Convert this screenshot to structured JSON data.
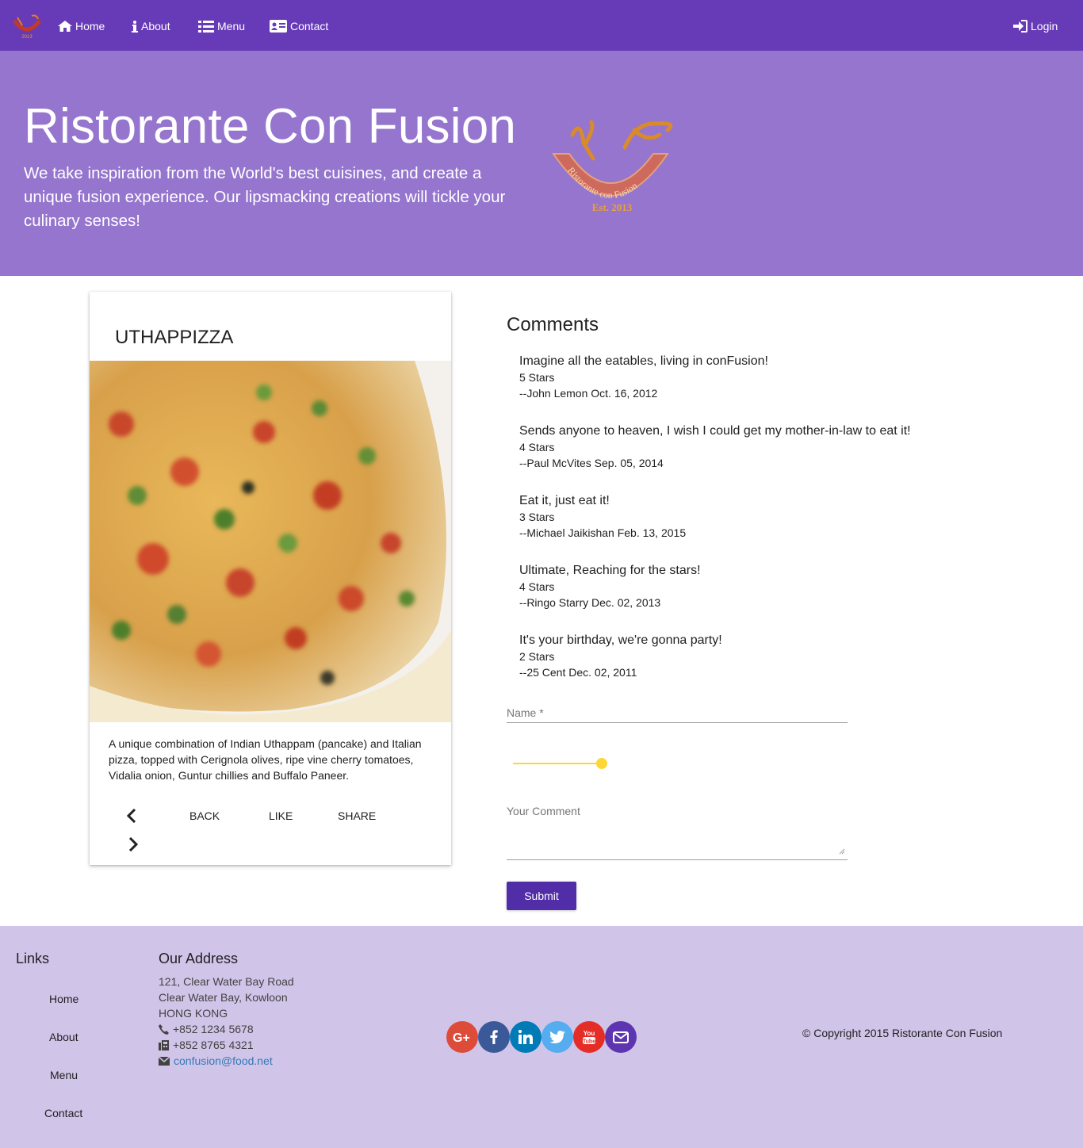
{
  "nav": {
    "items": [
      {
        "label": "Home",
        "icon": "home-icon"
      },
      {
        "label": "About",
        "icon": "info-icon"
      },
      {
        "label": "Menu",
        "icon": "list-icon"
      },
      {
        "label": "Contact",
        "icon": "address-card-icon"
      }
    ],
    "login": "Login"
  },
  "jumbotron": {
    "title": "Ristorante Con Fusion",
    "text": "We take inspiration from the World's best cuisines, and create a unique fusion experience. Our lipsmacking creations will tickle your culinary senses!",
    "logo_text": "Ristorante con Fusion",
    "logo_est": "Est. 2013"
  },
  "dish": {
    "name": "UTHAPPIZZA",
    "description": "A unique combination of Indian Uthappam (pancake) and Italian pizza, topped with Cerignola olives, ripe vine cherry tomatoes, Vidalia onion, Guntur chillies and Buffalo Paneer.",
    "actions": {
      "back": "BACK",
      "like": "LIKE",
      "share": "SHARE"
    }
  },
  "comments": {
    "title": "Comments",
    "items": [
      {
        "comment": "Imagine all the eatables, living in conFusion!",
        "rating": "5 Stars",
        "author": "--John Lemon Oct. 16, 2012"
      },
      {
        "comment": "Sends anyone to heaven, I wish I could get my mother-in-law to eat it!",
        "rating": "4 Stars",
        "author": "--Paul McVites Sep. 05, 2014"
      },
      {
        "comment": "Eat it, just eat it!",
        "rating": "3 Stars",
        "author": "--Michael Jaikishan Feb. 13, 2015"
      },
      {
        "comment": "Ultimate, Reaching for the stars!",
        "rating": "4 Stars",
        "author": "--Ringo Starry Dec. 02, 2013"
      },
      {
        "comment": "It's your birthday, we're gonna party!",
        "rating": "2 Stars",
        "author": "--25 Cent Dec. 02, 2011"
      }
    ]
  },
  "form": {
    "name_label": "Name *",
    "rating_value": 5,
    "rating_max": 5,
    "comment_label": "Your Comment",
    "submit": "Submit"
  },
  "footer": {
    "links_heading": "Links",
    "links": [
      "Home",
      "About",
      "Menu",
      "Contact"
    ],
    "address_heading": "Our Address",
    "address": [
      "121, Clear Water Bay Road",
      "Clear Water Bay, Kowloon",
      "HONG KONG"
    ],
    "phone": "+852 1234 5678",
    "fax": "+852 8765 4321",
    "email": "confusion@food.net",
    "social": [
      {
        "name": "google-plus-icon",
        "color": "#dd4b39"
      },
      {
        "name": "facebook-icon",
        "color": "#3b5998"
      },
      {
        "name": "linkedin-icon",
        "color": "#007bb6"
      },
      {
        "name": "twitter-icon",
        "color": "#55acee"
      },
      {
        "name": "youtube-icon",
        "color": "#e52d27"
      },
      {
        "name": "mail-icon",
        "color": "#5e35b1"
      }
    ],
    "copyright": "© Copyright 2015 Ristorante Con Fusion"
  },
  "colors": {
    "primary": "#673ab7",
    "primary_light": "#9575cd",
    "footer_bg": "#d1c4e9",
    "accent": "#fdd835",
    "button": "#512da8"
  }
}
